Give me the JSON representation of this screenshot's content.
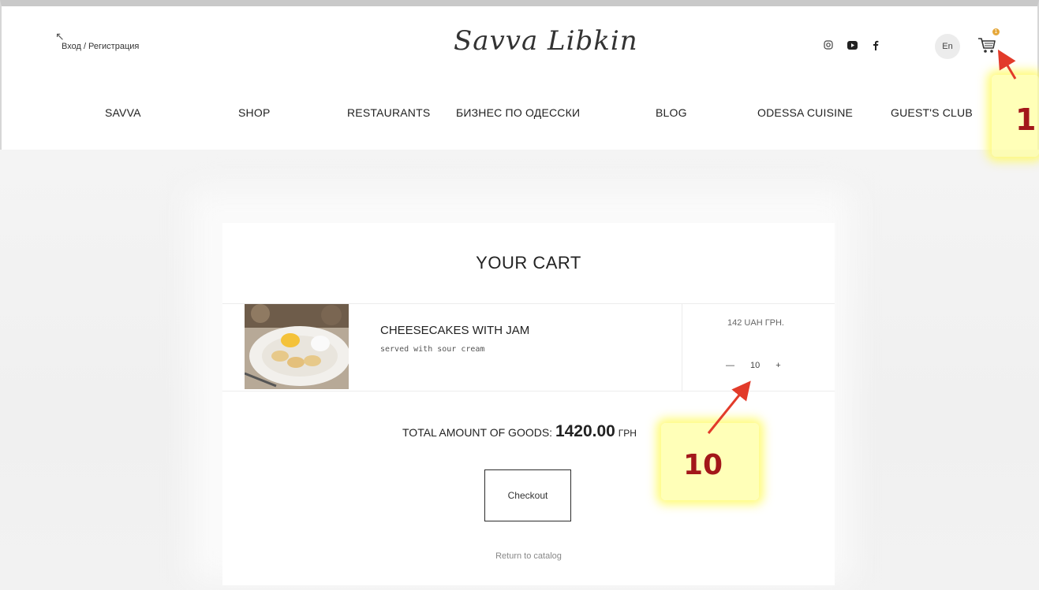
{
  "header": {
    "auth_label": "Вход / Регистрация",
    "logo_text": "Savva Libkin",
    "lang": "En",
    "cart_count": "1",
    "social_icons": [
      "instagram-icon",
      "youtube-icon",
      "facebook-icon"
    ]
  },
  "nav": {
    "items": [
      {
        "label": "SAVVA"
      },
      {
        "label": "SHOP"
      },
      {
        "label": "RESTAURANTS"
      },
      {
        "label": "БИЗНЕС ПО ОДЕССКИ"
      },
      {
        "label": "BLOG"
      },
      {
        "label": "ODESSA CUISINE"
      },
      {
        "label": "GUEST'S CLUB"
      }
    ]
  },
  "cart": {
    "title": "YOUR CART",
    "items": [
      {
        "name": "CHEESECAKES WITH JAM",
        "description": "served with sour cream",
        "price": "142 UAH ГРН.",
        "quantity": "10",
        "minus": "—",
        "plus": "+"
      }
    ],
    "total_label": "TOTAL AMOUNT OF GOODS:",
    "total_amount": "1420.00",
    "total_currency": "ГРН",
    "checkout_label": "Checkout",
    "return_label": "Return to catalog"
  },
  "annotations": {
    "badge_1": "1",
    "badge_10": "10"
  },
  "colors": {
    "annotation_highlight": "#fff86a",
    "annotation_text": "#a3171a",
    "arrow": "#e23b2a",
    "cart_badge": "#e5a73a"
  }
}
